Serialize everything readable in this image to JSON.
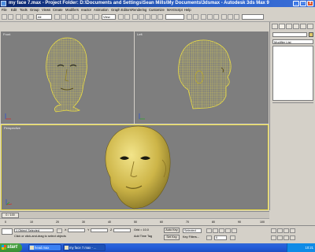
{
  "window": {
    "title": "my face 7.max    - Project Folder: D:\\Documents and Settings\\Sean Mills\\My Documents\\3dsmax    - Autodesk 3ds Max 9",
    "minimize": "_",
    "maximize": "□",
    "close": "x"
  },
  "menu": [
    "File",
    "Edit",
    "Tools",
    "Group",
    "Views",
    "Create",
    "Modifiers",
    "reactor",
    "Animation",
    "Graph Editors",
    "Rendering",
    "Customize",
    "MAXScript",
    "Help"
  ],
  "toolbar": {
    "selection_filter": "All",
    "coord_system": "View",
    "named_selection": ""
  },
  "viewports": {
    "top_left": {
      "label": "Front"
    },
    "top_right": {
      "label": "Left"
    },
    "bottom": {
      "label": "Perspective"
    }
  },
  "command_panel": {
    "object_name": "",
    "modifier_list": "Modifier List"
  },
  "timeline": {
    "frame_counter": "0 / 100",
    "ticks": [
      "0",
      "10",
      "20",
      "30",
      "40",
      "50",
      "60",
      "70",
      "80",
      "90",
      "100"
    ]
  },
  "status": {
    "selection_info": "1 Object Selected",
    "prompt": "Click or click-and-drag to select objects",
    "grid": "Grid = 10.0",
    "time_tag": "Add Time Tag",
    "auto_key": "Auto Key",
    "set_key": "Set Key",
    "key_mode": "Selected",
    "key_filters": "Key Filters...",
    "frame": "0",
    "coord_x": "",
    "coord_y": "",
    "coord_z": ""
  },
  "taskbar": {
    "start_label": "start",
    "tasks": [
      "head.max",
      "my face 7.max - ..."
    ],
    "clock": "10:21"
  },
  "colors": {
    "mesh_wire": "#e8d84a",
    "mesh_shaded": "#d4c050",
    "viewport_bg": "#7e7e7e",
    "active_viewport_border": "#f0e040"
  }
}
